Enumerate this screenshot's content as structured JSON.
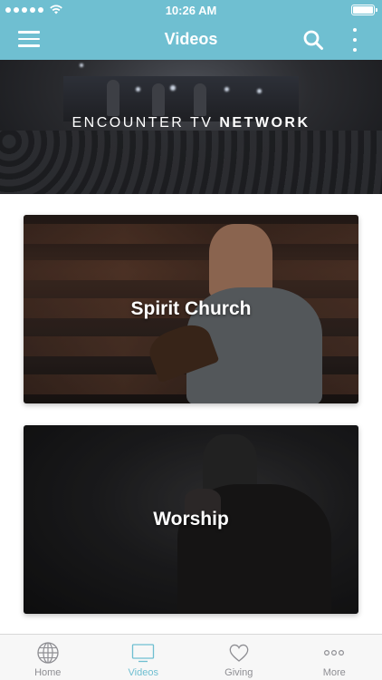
{
  "status_bar": {
    "time": "10:26 AM",
    "signal_dots": 5,
    "battery_level": 1.0
  },
  "nav": {
    "title": "Videos",
    "menu_icon": "hamburger-menu-icon",
    "search_icon": "search-icon",
    "more_icon": "vertical-ellipsis-icon"
  },
  "hero": {
    "text_light": "ENCOUNTER TV ",
    "text_bold": "NETWORK"
  },
  "cards": [
    {
      "title": "Spirit Church"
    },
    {
      "title": "Worship"
    }
  ],
  "tabs": [
    {
      "label": "Home",
      "icon": "globe-icon",
      "active": false
    },
    {
      "label": "Videos",
      "icon": "tv-icon",
      "active": true
    },
    {
      "label": "Giving",
      "icon": "heart-icon",
      "active": false
    },
    {
      "label": "More",
      "icon": "more-dots-icon",
      "active": false
    }
  ],
  "colors": {
    "accent": "#6fbfd1",
    "tab_inactive": "#8e8e93"
  }
}
